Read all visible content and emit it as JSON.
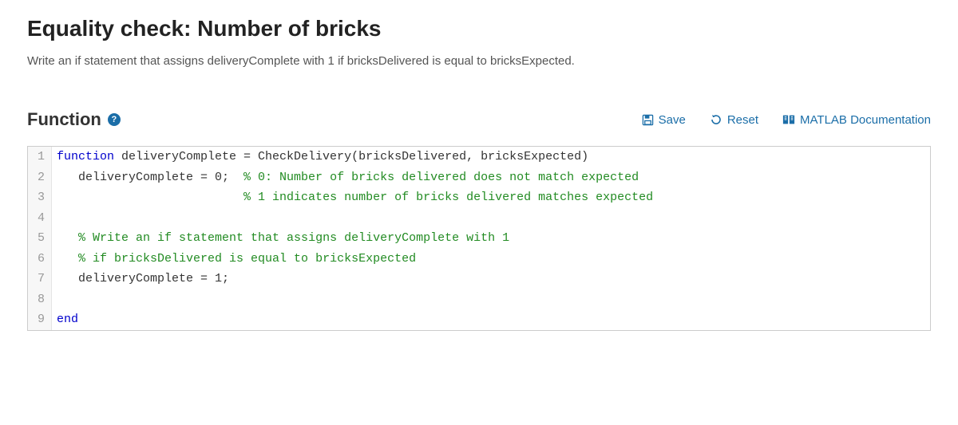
{
  "title": "Equality check: Number of bricks",
  "instructions": "Write an if statement that assigns deliveryComplete with 1 if bricksDelivered is equal to bricksExpected.",
  "section": {
    "label": "Function",
    "help_glyph": "?"
  },
  "actions": {
    "save": "Save",
    "reset": "Reset",
    "docs": "MATLAB Documentation"
  },
  "code": {
    "lines": [
      {
        "n": "1",
        "t": [
          {
            "c": "kw",
            "s": "function"
          },
          {
            "c": "",
            "s": " deliveryComplete = CheckDelivery(bricksDelivered, bricksExpected)"
          }
        ]
      },
      {
        "n": "2",
        "t": [
          {
            "c": "",
            "s": "   deliveryComplete = 0;  "
          },
          {
            "c": "com",
            "s": "% 0: Number of bricks delivered does not match expected"
          }
        ]
      },
      {
        "n": "3",
        "t": [
          {
            "c": "",
            "s": "                          "
          },
          {
            "c": "com",
            "s": "% 1 indicates number of bricks delivered matches expected"
          }
        ]
      },
      {
        "n": "4",
        "t": [
          {
            "c": "",
            "s": ""
          }
        ]
      },
      {
        "n": "5",
        "t": [
          {
            "c": "",
            "s": "   "
          },
          {
            "c": "com",
            "s": "% Write an if statement that assigns deliveryComplete with 1"
          }
        ]
      },
      {
        "n": "6",
        "t": [
          {
            "c": "",
            "s": "   "
          },
          {
            "c": "com",
            "s": "% if bricksDelivered is equal to bricksExpected"
          }
        ]
      },
      {
        "n": "7",
        "t": [
          {
            "c": "",
            "s": "   deliveryComplete = 1;"
          }
        ]
      },
      {
        "n": "8",
        "t": [
          {
            "c": "",
            "s": ""
          }
        ]
      },
      {
        "n": "9",
        "t": [
          {
            "c": "kw",
            "s": "end"
          }
        ]
      }
    ]
  }
}
